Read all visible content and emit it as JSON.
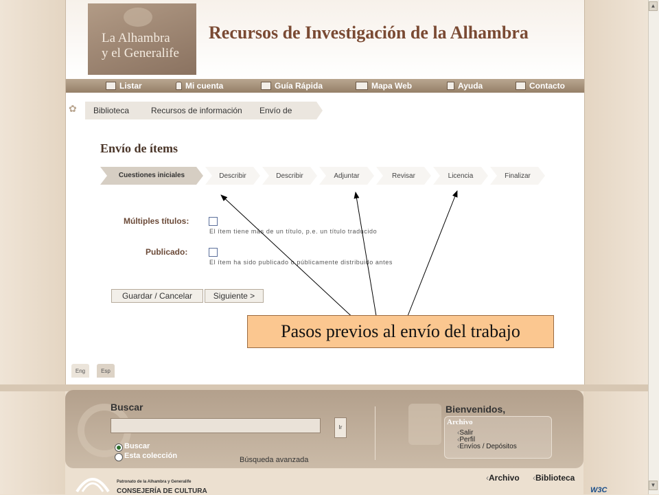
{
  "header": {
    "logo_line1": "La Alhambra",
    "logo_line2": "y el Generalife",
    "title": "Recursos de Investigación de la Alhambra"
  },
  "nav": {
    "items": [
      {
        "label": "Listar",
        "icon": "list-icon"
      },
      {
        "label": "Mi cuenta",
        "icon": "user-icon"
      },
      {
        "label": "Guía Rápida",
        "icon": "guide-icon"
      },
      {
        "label": "Mapa Web",
        "icon": "sitemap-icon"
      },
      {
        "label": "Ayuda",
        "icon": "help-icon"
      },
      {
        "label": "Contacto",
        "icon": "mail-icon"
      }
    ]
  },
  "breadcrumb": [
    "Biblioteca",
    "Recursos de información",
    "Envío de ítems"
  ],
  "page": {
    "heading": "Envío de ítems"
  },
  "steps": [
    "Cuestiones iniciales",
    "Describir",
    "Describir",
    "Adjuntar",
    "Revisar",
    "Licencia",
    "Finalizar"
  ],
  "form": {
    "multiple_titles": {
      "label": "Múltiples títulos:",
      "help": "El ítem tiene más de un título, p.e. un título traducido"
    },
    "published": {
      "label": "Publicado:",
      "help": "El ítem ha sido publicado o públicamente distribuido antes"
    },
    "save_cancel": "Guardar / Cancelar",
    "next": "Siguiente >"
  },
  "lang": {
    "eng": "Eng",
    "esp": "Esp"
  },
  "callout": "Pasos previos al envío del trabajo",
  "footer": {
    "search_title": "Buscar",
    "go_label": "Ir",
    "radio_all": "Buscar",
    "radio_collection": "Esta colección",
    "advanced": "Búsqueda avanzada",
    "welcome": "Bienvenidos,",
    "menu_head": "Archivo",
    "menu_items": [
      "Salir",
      "Perfil",
      "Envíos / Depósitos"
    ]
  },
  "bottom": {
    "archivo": "Archivo",
    "biblioteca": "Biblioteca",
    "org_line1": "Patronato de la Alhambra y Generalife",
    "org_line2": "CONSEJERÍA DE CULTURA",
    "w3c": "W3C"
  }
}
